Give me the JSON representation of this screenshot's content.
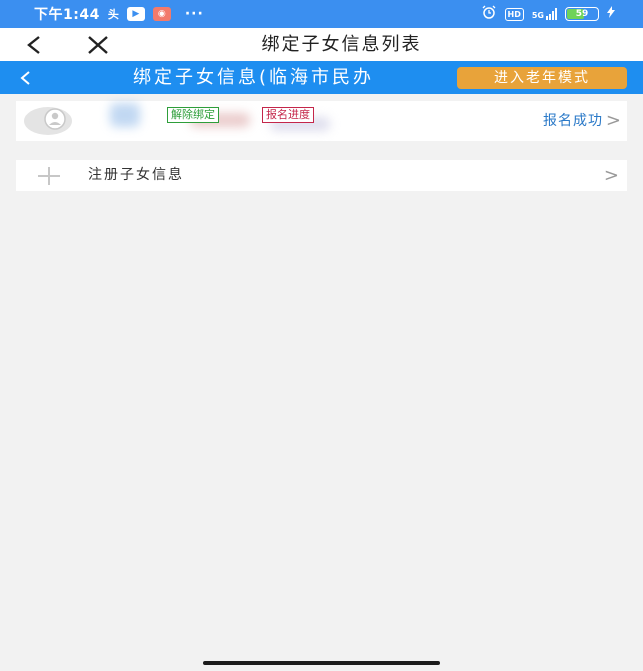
{
  "status_bar": {
    "time": "下午1:44",
    "toutiao_icon": "头",
    "dots": "···",
    "hd_label": "HD",
    "network": "5G",
    "battery": "59",
    "battery_level": 0.59,
    "icons": [
      "toutiao-icon",
      "play-icon",
      "app-icon",
      "alarm-icon",
      "signal-icon",
      "battery-icon",
      "charging-icon"
    ]
  },
  "nav": {
    "back_glyph": "<",
    "close_glyph": "✕",
    "title": "绑定子女信息列表"
  },
  "header": {
    "back_glyph": "<",
    "title": "绑定子女信息(临海市民办",
    "elder_mode_button": "进入老年模式"
  },
  "child_card": {
    "unbind_tag": "解除绑定",
    "progress_tag": "报名进度",
    "status": "报名成功",
    "chevron": ">"
  },
  "register": {
    "label": "注册子女信息",
    "chevron": ">"
  },
  "colors": {
    "status_bar": "#3b8ff0",
    "header": "#1e8ef0",
    "elder_button": "#e8a33a",
    "unbind_tag": "#2e9e3a",
    "progress_tag": "#c4264a",
    "status_text": "#2a79c8",
    "background": "#f2f2f2"
  }
}
